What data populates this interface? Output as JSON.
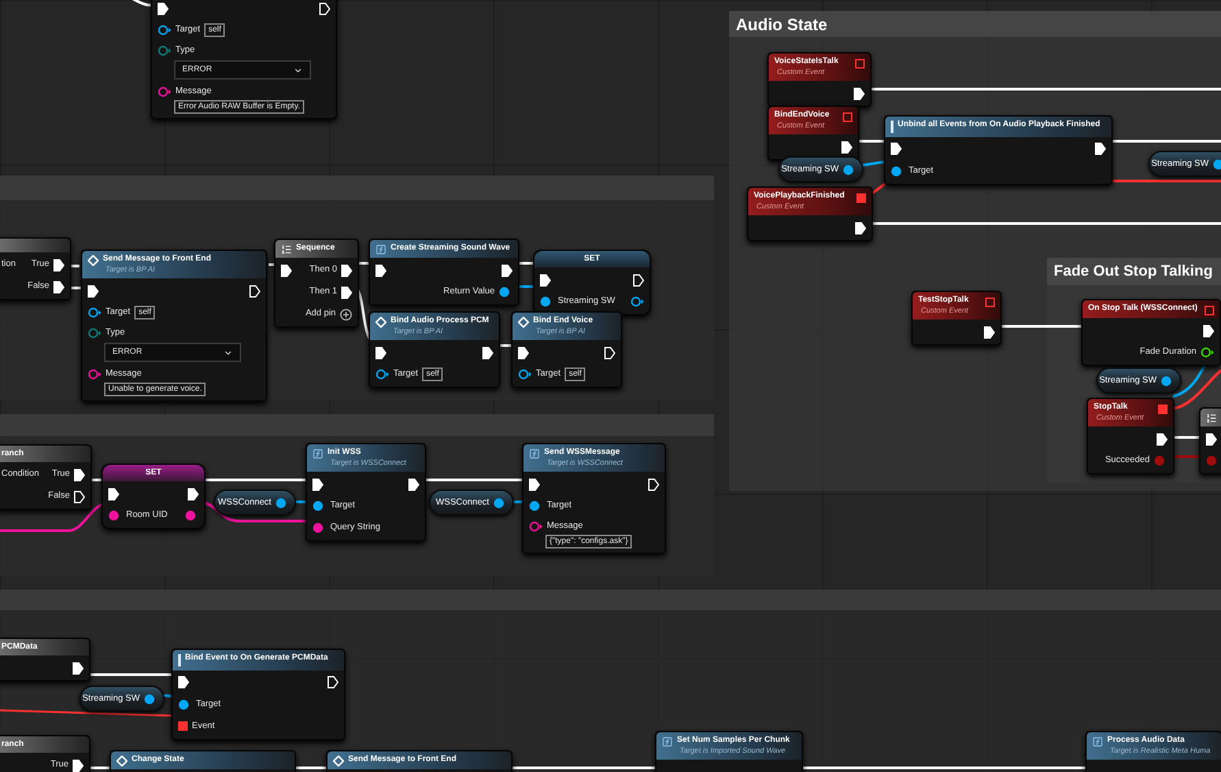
{
  "comments": [
    {
      "title": "Audio State"
    },
    {
      "title": "Fade Out Stop Talking"
    }
  ],
  "nodes": [
    {
      "kind": "function",
      "inputs": [
        {
          "kind": "exec",
          "connected": true
        },
        {
          "kind": "object",
          "label": "Target",
          "value": "self",
          "connected": false
        },
        {
          "kind": "enum",
          "label": "Type",
          "value": "ERROR",
          "connected": false
        },
        {
          "kind": "string",
          "label": "Message",
          "value": "Error Audio RAW Buffer is Empty.",
          "connected": false
        }
      ],
      "outputs": [
        {
          "kind": "exec",
          "connected": false
        }
      ]
    },
    {
      "kind": "macro",
      "inputs": [
        {
          "label": "tion"
        }
      ],
      "outputs": [
        {
          "kind": "exec",
          "label": "True",
          "connected": true
        },
        {
          "kind": "exec",
          "label": "False",
          "connected": true
        }
      ]
    },
    {
      "kind": "function",
      "title": "Send Message to Front End",
      "subtitle": "Target is BP AI",
      "inputs": [
        {
          "kind": "exec",
          "connected": true
        },
        {
          "kind": "object",
          "label": "Target",
          "value": "self",
          "connected": false
        },
        {
          "kind": "enum",
          "label": "Type",
          "value": "ERROR",
          "connected": false
        },
        {
          "kind": "string",
          "label": "Message",
          "value": "Unable to generate voice.",
          "connected": false
        }
      ],
      "outputs": [
        {
          "kind": "exec",
          "connected": false
        }
      ]
    },
    {
      "kind": "macro",
      "title": "Sequence",
      "inputs": [
        {
          "kind": "exec",
          "connected": true
        }
      ],
      "outputs": [
        {
          "kind": "exec",
          "label": "Then 0",
          "connected": true
        },
        {
          "kind": "exec",
          "label": "Then 1",
          "connected": true
        },
        {
          "kind": "add",
          "label": "Add pin",
          "connected": false
        }
      ]
    },
    {
      "kind": "function",
      "title": "Create Streaming Sound Wave",
      "inputs": [
        {
          "kind": "exec",
          "connected": true
        }
      ],
      "outputs": [
        {
          "kind": "exec",
          "connected": true
        },
        {
          "kind": "object",
          "label": "Return Value",
          "connected": true
        }
      ]
    },
    {
      "kind": "set",
      "title": "SET",
      "inputs": [
        {
          "kind": "exec",
          "connected": true
        },
        {
          "kind": "object",
          "label": "Streaming SW",
          "connected": true
        }
      ],
      "outputs": [
        {
          "kind": "exec",
          "connected": false
        },
        {
          "kind": "object",
          "connected": false
        }
      ]
    },
    {
      "kind": "function",
      "title": "Bind Audio Process PCM",
      "subtitle": "Target is BP AI",
      "inputs": [
        {
          "kind": "exec",
          "connected": true
        },
        {
          "kind": "object",
          "label": "Target",
          "value": "self",
          "connected": false
        }
      ],
      "outputs": [
        {
          "kind": "exec",
          "connected": true
        }
      ]
    },
    {
      "kind": "function",
      "title": "Bind End Voice",
      "subtitle": "Target is BP AI",
      "inputs": [
        {
          "kind": "exec",
          "connected": true
        },
        {
          "kind": "object",
          "label": "Target",
          "value": "self",
          "connected": false
        }
      ],
      "outputs": [
        {
          "kind": "exec",
          "connected": false
        }
      ]
    },
    {
      "kind": "macro",
      "title": "ranch",
      "inputs": [
        {
          "label": "Condition"
        }
      ],
      "outputs": [
        {
          "kind": "exec",
          "label": "True",
          "connected": true
        },
        {
          "kind": "exec",
          "label": "False",
          "connected": false
        }
      ]
    },
    {
      "kind": "set",
      "title": "SET",
      "inputs": [
        {
          "kind": "exec",
          "connected": true
        },
        {
          "kind": "string",
          "label": "Room UID",
          "connected": true
        }
      ],
      "outputs": [
        {
          "kind": "exec",
          "connected": true
        },
        {
          "kind": "string",
          "connected": true
        }
      ]
    },
    {
      "kind": "variable",
      "label": "WSSConnect",
      "connected": true
    },
    {
      "kind": "function",
      "title": "Init WSS",
      "subtitle": "Target is WSSConnect",
      "inputs": [
        {
          "kind": "exec",
          "connected": true
        },
        {
          "kind": "object",
          "label": "Target",
          "connected": true
        },
        {
          "kind": "string",
          "label": "Query String",
          "connected": true
        }
      ],
      "outputs": [
        {
          "kind": "exec",
          "connected": true
        }
      ]
    },
    {
      "kind": "variable",
      "label": "WSSConnect",
      "connected": true
    },
    {
      "kind": "function",
      "title": "Send WSSMessage",
      "subtitle": "Target is WSSConnect",
      "inputs": [
        {
          "kind": "exec",
          "connected": true
        },
        {
          "kind": "object",
          "label": "Target",
          "connected": true
        },
        {
          "kind": "string",
          "label": "Message",
          "value": "{\"type\": \"configs.ask\"}",
          "connected": false
        }
      ],
      "outputs": [
        {
          "kind": "exec",
          "connected": false
        }
      ]
    },
    {
      "kind": "event",
      "title": "VoiceStateIsTalk",
      "subtitle": "Custom Event",
      "delegate_connected": false,
      "outputs": [
        {
          "kind": "exec",
          "connected": true
        }
      ]
    },
    {
      "kind": "event",
      "title": "BindEndVoice",
      "subtitle": "Custom Event",
      "delegate_connected": false,
      "outputs": [
        {
          "kind": "exec",
          "connected": true
        }
      ]
    },
    {
      "kind": "variable",
      "label": "Streaming SW",
      "connected": true
    },
    {
      "kind": "function",
      "title": "Unbind all Events from On Audio Playback Finished",
      "inputs": [
        {
          "kind": "exec",
          "connected": true
        },
        {
          "kind": "object",
          "label": "Target",
          "connected": true
        }
      ],
      "outputs": [
        {
          "kind": "exec",
          "connected": true
        }
      ]
    },
    {
      "kind": "variable",
      "label": "Streaming SW",
      "connected": true
    },
    {
      "kind": "event",
      "title": "VoicePlaybackFinished",
      "subtitle": "Custom Event",
      "delegate_connected": true,
      "outputs": [
        {
          "kind": "exec",
          "connected": true
        }
      ]
    },
    {
      "kind": "event",
      "title": "TestStopTalk",
      "subtitle": "Custom Event",
      "delegate_connected": false,
      "outputs": [
        {
          "kind": "exec",
          "connected": true
        }
      ]
    },
    {
      "kind": "event",
      "title": "On Stop Talk (WSSConnect)",
      "delegate_connected": false,
      "outputs": [
        {
          "kind": "exec",
          "connected": true
        },
        {
          "kind": "float",
          "label": "Fade Duration",
          "connected": false
        }
      ]
    },
    {
      "kind": "variable",
      "label": "Streaming SW",
      "connected": true
    },
    {
      "kind": "event",
      "title": "StopTalk",
      "subtitle": "Custom Event",
      "delegate_connected": true,
      "outputs": [
        {
          "kind": "exec",
          "connected": true
        },
        {
          "kind": "bool",
          "label": "Succeeded",
          "connected": true
        }
      ]
    },
    {
      "kind": "macro",
      "inputs": [
        {
          "kind": "exec",
          "connected": true
        },
        {
          "kind": "bool",
          "connected": true
        }
      ]
    },
    {
      "kind": "macro",
      "title": "PCMData",
      "outputs": [
        {
          "kind": "exec",
          "connected": true
        }
      ]
    },
    {
      "kind": "function",
      "title": "Bind Event to On Generate PCMData",
      "inputs": [
        {
          "kind": "exec",
          "connected": true
        },
        {
          "kind": "object",
          "label": "Target",
          "connected": true
        },
        {
          "kind": "delegate",
          "label": "Event",
          "connected": true
        }
      ],
      "outputs": [
        {
          "kind": "exec",
          "connected": false
        }
      ]
    },
    {
      "kind": "variable",
      "label": "Streaming SW",
      "connected": true
    },
    {
      "kind": "macro",
      "title": "ranch",
      "outputs": [
        {
          "kind": "exec",
          "label": "True",
          "connected": true
        }
      ]
    },
    {
      "kind": "function",
      "title": "Change State"
    },
    {
      "kind": "function",
      "title": "Send Message to Front End"
    },
    {
      "kind": "function",
      "title": "Set Num Samples Per Chunk",
      "subtitle": "Target is Imported Sound Wave"
    },
    {
      "kind": "function",
      "title": "Process Audio Data",
      "subtitle": "Target is Realistic Meta Huma"
    }
  ]
}
